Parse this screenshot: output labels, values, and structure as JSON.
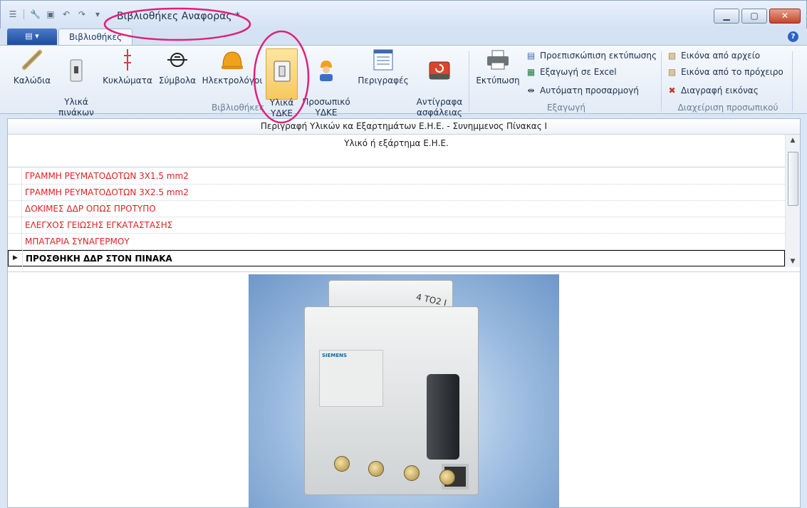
{
  "window": {
    "title": "Βιβλιοθήκες Αναφοράς *",
    "buttons": {
      "minimize": "▁",
      "maximize": "▢",
      "close": "✕"
    }
  },
  "ribbon": {
    "app_button_label": "▤ ▾",
    "active_tab": "Βιβλιοθήκες",
    "help": "?",
    "groups": {
      "libraries": {
        "label": "Βιβλιοθήκες",
        "buttons": [
          {
            "label": "Καλώδια",
            "icon": "cable-icon"
          },
          {
            "label": "Υλικά\nπινάκων",
            "icon": "breaker-icon"
          },
          {
            "label": "Κυκλώματα",
            "icon": "circuit-icon"
          },
          {
            "label": "Σύμβολα",
            "icon": "symbol-icon"
          },
          {
            "label": "Ηλεκτρολόγοι",
            "icon": "electrician-icon"
          },
          {
            "label": "Υλικά\nΥΔΚΕ",
            "icon": "switch-icon"
          },
          {
            "label": "Προσωπικό\nΥΔΚΕ",
            "icon": "worker-icon"
          },
          {
            "label": "Περιγραφές",
            "icon": "list-icon"
          },
          {
            "label": "Αντίγραφα\nασφάλειας",
            "icon": "backup-icon"
          }
        ]
      },
      "export": {
        "label": "Εξαγωγή",
        "print_label": "Εκτύπωση",
        "items": [
          "Προεπισκώπιση εκτύπωσης",
          "Εξαγωγή σε Excel",
          "Αυτόματη προσαρμογή"
        ]
      },
      "staff": {
        "label": "Διαχείριση προσωπικού",
        "items": [
          "Εικόνα από αρχείο",
          "Εικόνα από το πρόχειρο",
          "Διαγραφή εικόνας"
        ]
      }
    }
  },
  "grid": {
    "caption": "Περιγραφή Υλικών κα Εξαρτημάτων Ε.Η.Ε. - Συνημμενος Πίνακας Ι",
    "column_header": "Υλικό ή εξάρτημα Ε.Η.Ε.",
    "rows": [
      "ΓΡΑΜΜΗ ΡΕΥΜΑΤΟΔΟΤΩΝ 3Χ1.5 mm2",
      "ΓΡΑΜΜΗ ΡΕΥΜΑΤΟΔΟΤΩΝ 3Χ2.5 mm2",
      "ΔΟΚΙΜΕΣ ΔΔΡ ΟΠΩΣ ΠΡΟΤΥΠΟ",
      "ΕΛΕΓΧΟΣ ΓΕΙΩΣΗΣ ΕΓΚΑΤΑΣΤΑΣΗΣ",
      "ΜΠΑΤΑΡΙΑ ΣΥΝΑΓΕΡΜΟΥ",
      "ΠΡΟΣΘΗΚΗ ΔΔΡ ΣΤΟΝ ΠΙΝΑΚΑ"
    ],
    "selected_row_marker": "▶",
    "scroll_up": "▲",
    "scroll_down": "▼"
  },
  "photo": {
    "brand": "SIEMENS",
    "marking": "4 ТО2 І"
  },
  "colors": {
    "row_text": "#e02020",
    "annotation": "#e0207a",
    "selected_button": "#f7c85e"
  }
}
